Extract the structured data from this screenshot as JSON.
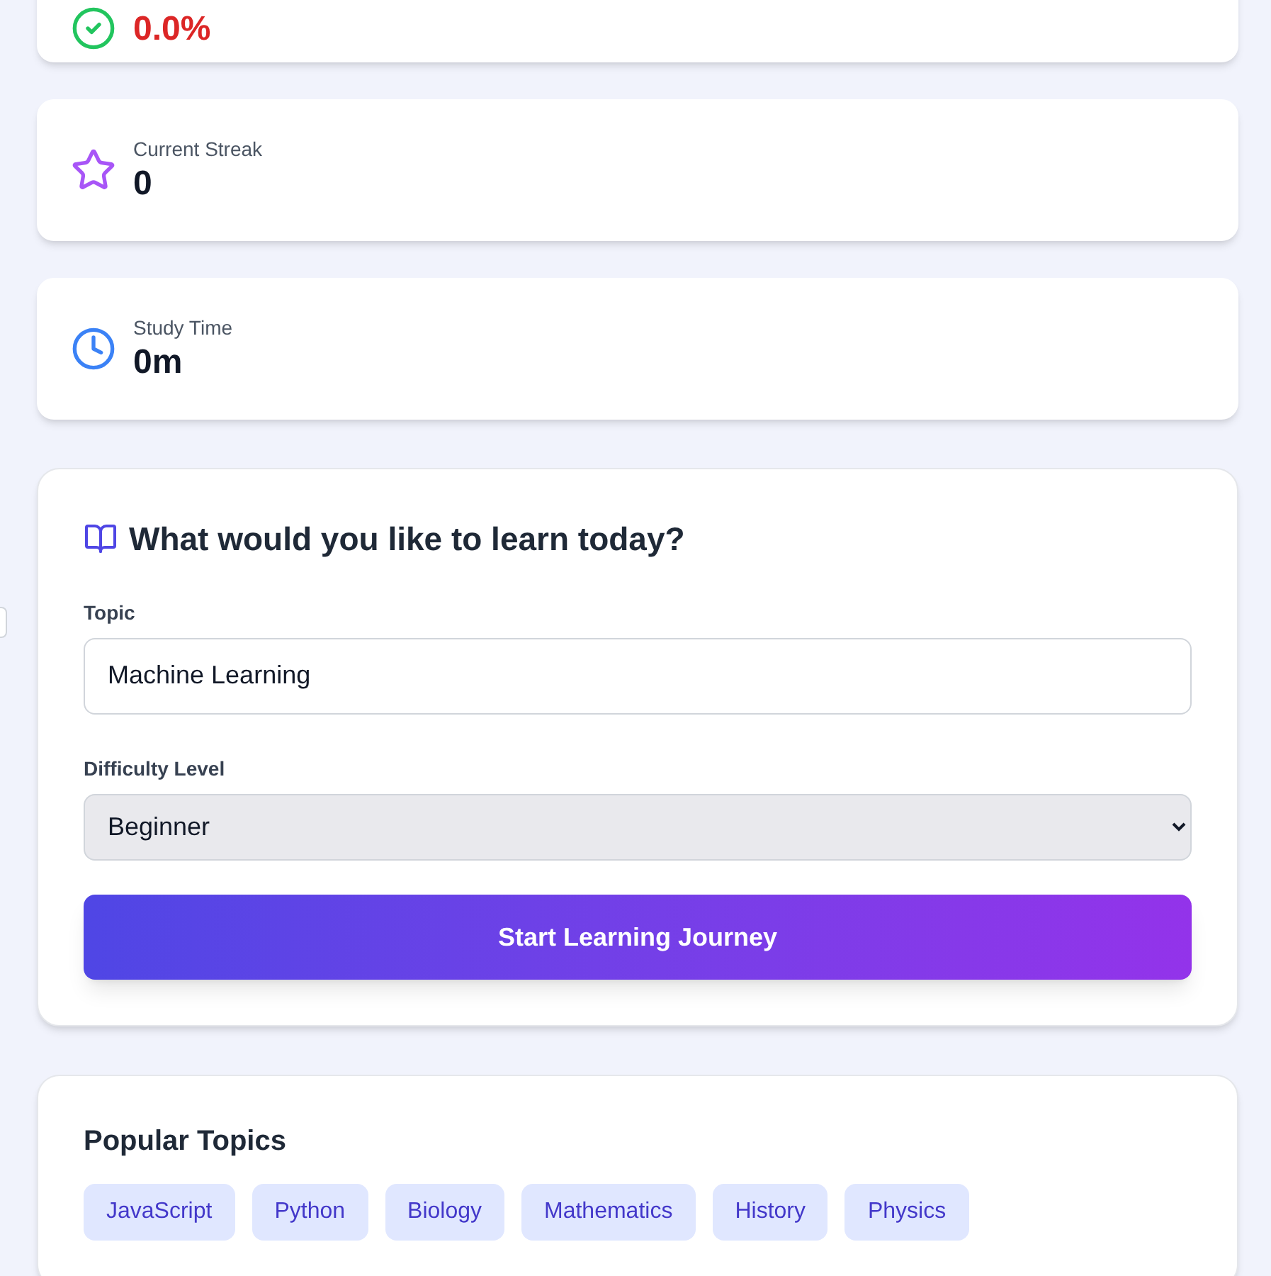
{
  "stats": [
    {
      "kind": "accuracy",
      "value": "0.0%",
      "color": "#dc2626"
    },
    {
      "kind": "streak",
      "label": "Current Streak",
      "value": "0",
      "color": "#111827"
    },
    {
      "kind": "time",
      "label": "Study Time",
      "value": "0m",
      "color": "#111827"
    }
  ],
  "form": {
    "title": "What would you like to learn today?",
    "topic_label": "Topic",
    "topic_value": "Machine Learning",
    "difficulty_label": "Difficulty Level",
    "difficulty_value": "Beginner",
    "submit": "Start Learning Journey"
  },
  "popular": {
    "title": "Popular Topics",
    "topics": [
      "JavaScript",
      "Python",
      "Biology",
      "Mathematics",
      "History",
      "Physics"
    ]
  }
}
